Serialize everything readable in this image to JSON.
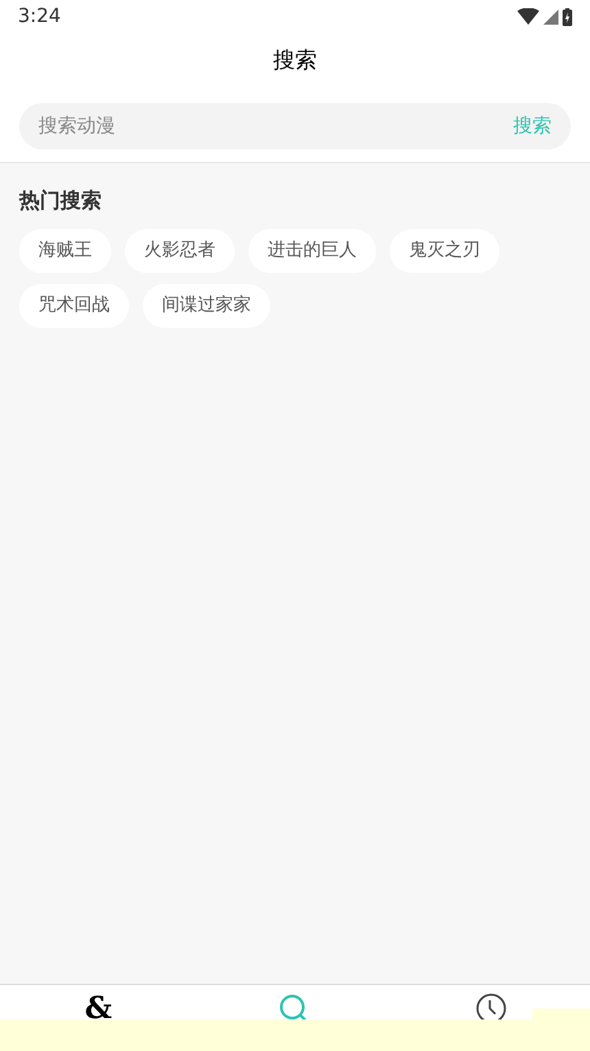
{
  "status_bar": {
    "time": "3:24"
  },
  "header": {
    "title": "搜索"
  },
  "search": {
    "placeholder": "搜索动漫",
    "button": "搜索"
  },
  "hot_searches": {
    "title": "热门搜索",
    "tags": [
      "海贼王",
      "火影忍者",
      "进击的巨人",
      "鬼灭之刃",
      "咒术回战",
      "间谍过家家"
    ]
  },
  "bottom_nav": [
    {
      "kind": "glyph",
      "glyph": "&",
      "selected": false
    },
    {
      "kind": "search",
      "selected": true
    },
    {
      "kind": "history",
      "selected": false
    }
  ]
}
